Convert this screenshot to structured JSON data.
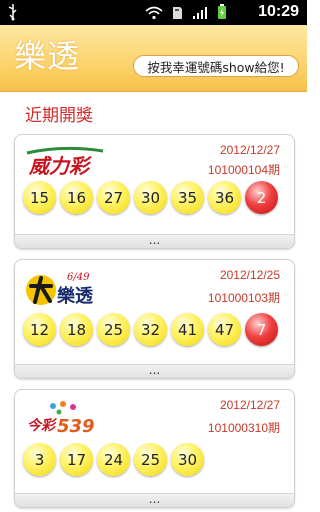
{
  "status_bar": {
    "time": "10:29",
    "icons": [
      "usb-icon",
      "wifi-icon",
      "sd-card-icon",
      "signal-icon",
      "battery-icon"
    ]
  },
  "header": {
    "title": "樂透",
    "show_button_label": "按我幸運號碼show給您!"
  },
  "section_title": "近期開獎",
  "draws": [
    {
      "game": "威力彩",
      "date": "2012/12/27",
      "period": "101000104期",
      "numbers": [
        "15",
        "16",
        "27",
        "30",
        "35",
        "36"
      ],
      "special": "2",
      "more": "..."
    },
    {
      "game": "大樂透",
      "logo_tag": "6/49",
      "date": "2012/12/25",
      "period": "101000103期",
      "numbers": [
        "12",
        "18",
        "25",
        "32",
        "41",
        "47"
      ],
      "special": "7",
      "more": "..."
    },
    {
      "game": "今彩539",
      "date": "2012/12/27",
      "period": "101000310期",
      "numbers": [
        "3",
        "17",
        "24",
        "25",
        "30"
      ],
      "special": null,
      "more": "..."
    }
  ],
  "colors": {
    "header_gold": "#fbcf63",
    "section_red": "#d22a2a",
    "date_red": "#c43a2a",
    "ball_yellow": "#f3d80a",
    "ball_red": "#e02020"
  }
}
